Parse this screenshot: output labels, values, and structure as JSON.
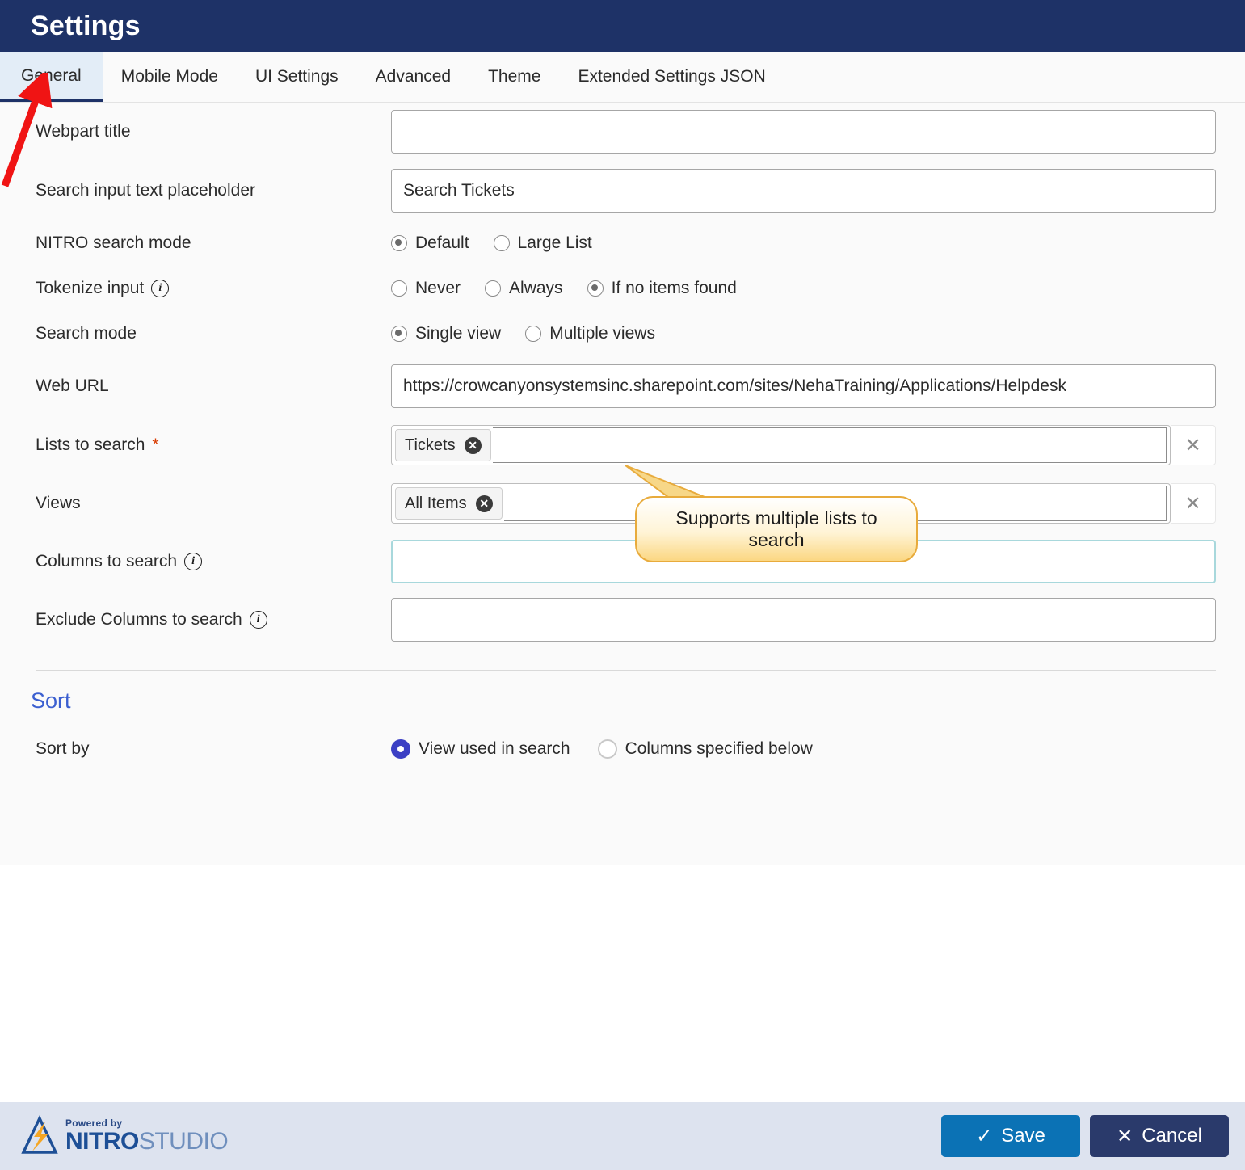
{
  "header": {
    "title": "Settings"
  },
  "tabs": [
    {
      "label": "General",
      "active": true
    },
    {
      "label": "Mobile Mode",
      "active": false
    },
    {
      "label": "UI Settings",
      "active": false
    },
    {
      "label": "Advanced",
      "active": false
    },
    {
      "label": "Theme",
      "active": false
    },
    {
      "label": "Extended Settings JSON",
      "active": false
    }
  ],
  "form": {
    "webpart_title": {
      "label": "Webpart title",
      "value": "",
      "placeholder": ""
    },
    "search_placeholder": {
      "label": "Search input text placeholder",
      "value": "Search Tickets",
      "placeholder": ""
    },
    "nitro_search_mode": {
      "label": "NITRO search mode",
      "options": [
        "Default",
        "Large List"
      ],
      "selected": "Default"
    },
    "tokenize_input": {
      "label": "Tokenize input",
      "info_icon": "info-icon",
      "options": [
        "Never",
        "Always",
        "If no items found"
      ],
      "selected": "If no items found"
    },
    "search_mode": {
      "label": "Search mode",
      "options": [
        "Single view",
        "Multiple views"
      ],
      "selected": "Single view"
    },
    "web_url": {
      "label": "Web URL",
      "value": "https://crowcanyonsystemsinc.sharepoint.com/sites/NehaTraining/Applications/Helpdesk",
      "placeholder": ""
    },
    "lists_to_search": {
      "label": "Lists to search",
      "required_marker": "*",
      "chips": [
        "Tickets"
      ],
      "input_value": "",
      "clear_icon": "close-icon"
    },
    "views": {
      "label": "Views",
      "chips": [
        "All Items"
      ],
      "input_value": "",
      "clear_icon": "close-icon"
    },
    "columns_to_search": {
      "label": "Columns to search",
      "info_icon": "info-icon",
      "value": "",
      "placeholder": ""
    },
    "exclude_columns_to_search": {
      "label": "Exclude Columns to search",
      "info_icon": "info-icon",
      "value": "",
      "placeholder": ""
    }
  },
  "sort_section": {
    "title": "Sort",
    "sort_by": {
      "label": "Sort by",
      "options": [
        "View used in search",
        "Columns specified below"
      ],
      "selected": "View used in search"
    }
  },
  "annotations": {
    "callout_text": "Supports multiple lists to search",
    "arrow_color": "#f01414",
    "callout_border_color": "#e8ab3c"
  },
  "footer": {
    "logo": {
      "powered_by": "Powered by",
      "brand_bold": "NITRO",
      "brand_light": "STUDIO",
      "mark_icon": "nitro-lightning-triangle-icon"
    },
    "save_label": "Save",
    "save_icon": "check-icon",
    "cancel_label": "Cancel",
    "cancel_icon": "close-icon"
  },
  "colors": {
    "header_bg": "#1e3267",
    "active_tab_bg": "#e3edf7",
    "panel_bg": "#fafafa",
    "footer_bg": "#dde3ef",
    "save_btn": "#0b72b5",
    "cancel_btn": "#2a3a6b",
    "section_title": "#3b5fd0",
    "focus_border": "#a8d8dc"
  }
}
